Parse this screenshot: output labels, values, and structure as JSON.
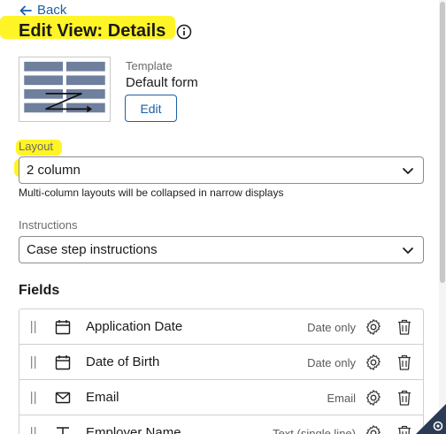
{
  "header": {
    "back_label": "Back",
    "title": "Edit View: Details"
  },
  "template": {
    "label": "Template",
    "value": "Default form",
    "edit_label": "Edit"
  },
  "layout": {
    "label": "Layout",
    "value": "2 column",
    "hint": "Multi-column layouts will be collapsed in narrow displays"
  },
  "instructions": {
    "label": "Instructions",
    "value": "Case step instructions"
  },
  "fields": {
    "title": "Fields",
    "rows": [
      {
        "name": "Application Date",
        "type": "Date only",
        "icon": "calendar-icon"
      },
      {
        "name": "Date of Birth",
        "type": "Date only",
        "icon": "calendar-icon"
      },
      {
        "name": "Email",
        "type": "Email",
        "icon": "envelope-icon"
      },
      {
        "name": "Employer Name",
        "type": "Text (single line)",
        "icon": "text-icon"
      }
    ]
  },
  "colors": {
    "accent": "#1b5fa8",
    "highlight": "#fff200",
    "corner": "#2b3a55"
  }
}
